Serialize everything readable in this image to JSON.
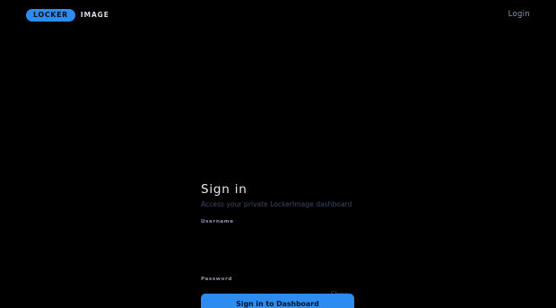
{
  "header": {
    "logo_badge": "LOCKER",
    "logo_text": "IMAGE",
    "login_label": "Login"
  },
  "form": {
    "title": "Sign in",
    "subtitle": "Access your private LockerImage dashboard",
    "username_label": "Username",
    "username_value": "",
    "password_label": "Password",
    "password_value": "",
    "show_label": "Show",
    "submit_label": "Sign in to Dashboard"
  },
  "colors": {
    "background": "#000000",
    "accent": "#2d8cf0",
    "muted_text": "#3f4868",
    "label_text": "#8d95ae"
  }
}
